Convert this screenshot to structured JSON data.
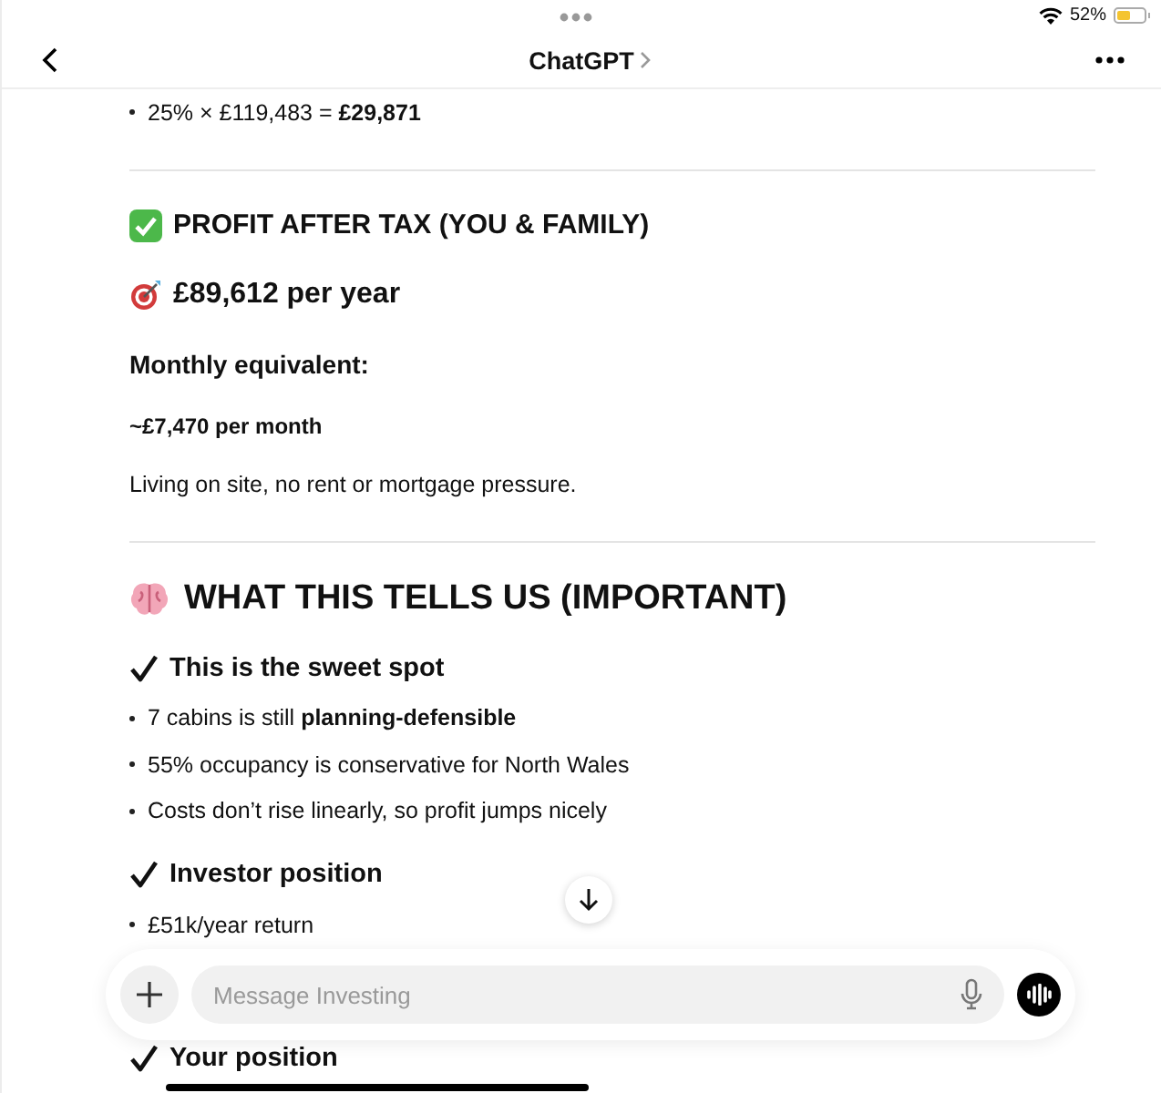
{
  "status_bar": {
    "battery": "52%"
  },
  "nav": {
    "title": "ChatGPT"
  },
  "blocks": [
    {
      "kind": "bullet",
      "text": "25% × £119,483 = **£29,871**"
    },
    {
      "kind": "divider"
    },
    {
      "kind": "done-heading",
      "text": "PROFIT AFTER TAX (YOU & FAMILY)"
    },
    {
      "kind": "target-line",
      "text": "£89,612 per year"
    },
    {
      "kind": "subheading",
      "text": "Monthly equivalent:"
    },
    {
      "kind": "strong",
      "text": "~£7,470 per month"
    },
    {
      "kind": "para",
      "text": "Living on site, no rent or mortgage pressure."
    },
    {
      "kind": "divider"
    },
    {
      "kind": "brain-heading",
      "text": "WHAT THIS TELLS US (IMPORTANT)"
    },
    {
      "kind": "tick-heading",
      "text": "This is the sweet spot"
    },
    {
      "kind": "bullet",
      "text": "7 cabins is still **planning-defensible**"
    },
    {
      "kind": "bullet",
      "text": "55% occupancy is conservative for North Wales"
    },
    {
      "kind": "bullet",
      "text": "Costs don’t rise linearly, so profit jumps nicely"
    },
    {
      "kind": "tick-heading",
      "text": "Investor position"
    },
    {
      "kind": "bullet",
      "text": "£51k/year return"
    },
    {
      "kind": "tick-heading",
      "text": "Your position"
    }
  ],
  "composer": {
    "placeholder": "Message Investing"
  }
}
